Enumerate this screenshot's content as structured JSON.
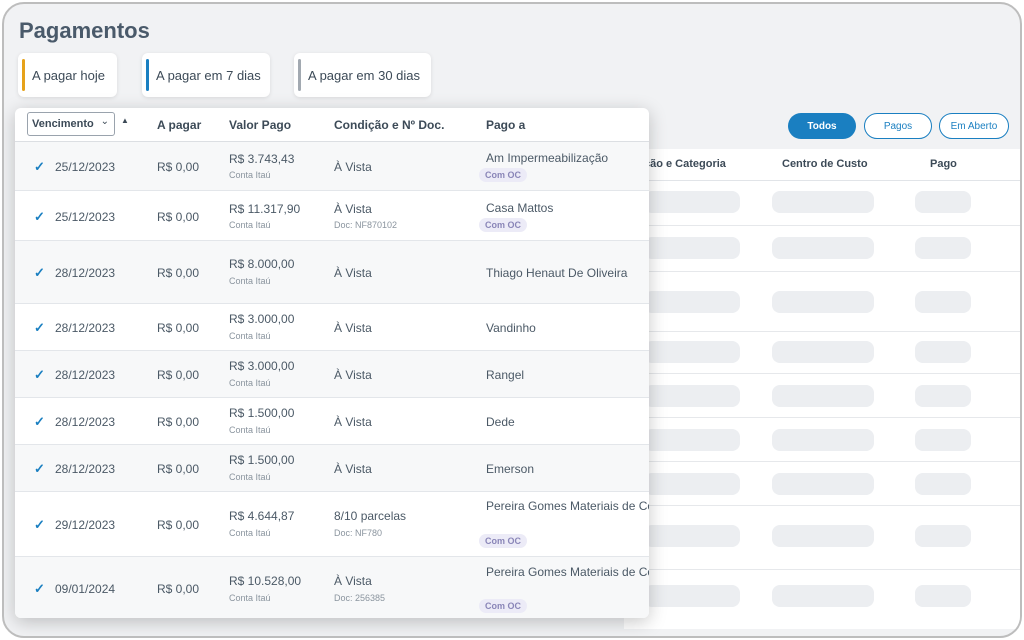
{
  "title": "Pagamentos",
  "cards": [
    {
      "label": "A pagar hoje",
      "color": "#e6a21a"
    },
    {
      "label": "A pagar em 7 dias",
      "color": "#1a7fc1"
    },
    {
      "label": "A pagar em 30 dias",
      "color": "#a2a9b1"
    }
  ],
  "filters": {
    "all": "Todos",
    "paid": "Pagos",
    "open": "Em Aberto"
  },
  "bg_headers": {
    "classification": "ção e Categoria",
    "cost_center": "Centro de Custo",
    "paid": "Pago"
  },
  "table": {
    "select_value": "Vencimento",
    "headers": {
      "to_pay": "A pagar",
      "paid_value": "Valor Pago",
      "condition": "Condição e Nº Doc.",
      "paid_to": "Pago a"
    }
  },
  "rows": [
    {
      "date": "25/12/2023",
      "to_pay": "R$ 0,00",
      "paid": "R$ 3.743,43",
      "account": "Conta Itaú",
      "condition": "À Vista",
      "doc": "",
      "payee": "Am Impermeabilização",
      "badge": "Com OC"
    },
    {
      "date": "25/12/2023",
      "to_pay": "R$ 0,00",
      "paid": "R$ 11.317,90",
      "account": "Conta Itaú",
      "condition": "À Vista",
      "doc": "Doc: NF870102",
      "payee": "Casa Mattos",
      "badge": "Com OC"
    },
    {
      "date": "28/12/2023",
      "to_pay": "R$ 0,00",
      "paid": "R$ 8.000,00",
      "account": "Conta Itaú",
      "condition": "À Vista",
      "doc": "",
      "payee": "Thiago Henaut De Oliveira",
      "badge": ""
    },
    {
      "date": "28/12/2023",
      "to_pay": "R$ 0,00",
      "paid": "R$ 3.000,00",
      "account": "Conta Itaú",
      "condition": "À Vista",
      "doc": "",
      "payee": "Vandinho",
      "badge": ""
    },
    {
      "date": "28/12/2023",
      "to_pay": "R$ 0,00",
      "paid": "R$ 3.000,00",
      "account": "Conta Itaú",
      "condition": "À Vista",
      "doc": "",
      "payee": "Rangel",
      "badge": ""
    },
    {
      "date": "28/12/2023",
      "to_pay": "R$ 0,00",
      "paid": "R$ 1.500,00",
      "account": "Conta Itaú",
      "condition": "À Vista",
      "doc": "",
      "payee": "Dede",
      "badge": ""
    },
    {
      "date": "28/12/2023",
      "to_pay": "R$ 0,00",
      "paid": "R$ 1.500,00",
      "account": "Conta Itaú",
      "condition": "À Vista",
      "doc": "",
      "payee": "Emerson",
      "badge": ""
    },
    {
      "date": "29/12/2023",
      "to_pay": "R$ 0,00",
      "paid": "R$ 4.644,87",
      "account": "Conta Itaú",
      "condition": "8/10 parcelas",
      "doc": "Doc: NF780",
      "payee": "Pereira Gomes Materiais de Construção",
      "badge": "Com OC"
    },
    {
      "date": "09/01/2024",
      "to_pay": "R$ 0,00",
      "paid": "R$ 10.528,00",
      "account": "Conta Itaú",
      "condition": "À Vista",
      "doc": "Doc: 256385",
      "payee": "Pereira Gomes Materiais de Construção",
      "badge": "Com OC"
    }
  ]
}
